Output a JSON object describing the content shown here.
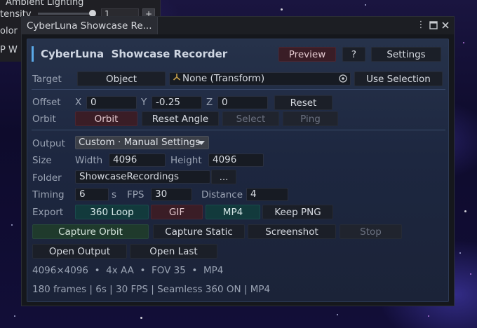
{
  "inspector": {
    "ambient_label": "Ambient Lighting",
    "intensity_label": "tensity",
    "intensity_value": "1",
    "plus_label": "+",
    "color_label": "olor",
    "p_label": "P W"
  },
  "window": {
    "tab_title": "CyberLuna Showcase Re...",
    "menu_icon": "kebab-menu-icon",
    "maximize_icon": "maximize-icon",
    "close_icon": "close-icon"
  },
  "header": {
    "title": "CyberLuna  Showcase Recorder",
    "preview": "Preview",
    "help": "?",
    "settings": "Settings"
  },
  "target": {
    "label": "Target",
    "object_button": "Object",
    "field_value": "None (Transform)",
    "use_selection": "Use Selection"
  },
  "offset": {
    "label": "Offset",
    "x_label": "X",
    "x_value": "0",
    "y_label": "Y",
    "y_value": "-0.25",
    "z_label": "Z",
    "z_value": "0",
    "reset": "Reset"
  },
  "orbit": {
    "label": "Orbit",
    "orbit_button": "Orbit",
    "reset_angle": "Reset Angle",
    "select": "Select",
    "ping": "Ping"
  },
  "output": {
    "label": "Output",
    "dropdown_value": "Custom · Manual Settings"
  },
  "size": {
    "label": "Size",
    "width_label": "Width",
    "width_value": "4096",
    "height_label": "Height",
    "height_value": "4096"
  },
  "folder": {
    "label": "Folder",
    "value": "ShowcaseRecordings",
    "browse": "..."
  },
  "timing": {
    "label": "Timing",
    "seconds_value": "6",
    "seconds_unit": "s",
    "fps_label": "FPS",
    "fps_value": "30",
    "distance_label": "Distance",
    "distance_value": "4"
  },
  "export": {
    "label": "Export",
    "loop": "360 Loop",
    "gif": "GIF",
    "mp4": "MP4",
    "keep_png": "Keep PNG"
  },
  "actions": {
    "capture_orbit": "Capture Orbit",
    "capture_static": "Capture Static",
    "screenshot": "Screenshot",
    "stop": "Stop",
    "open_output": "Open Output",
    "open_last": "Open Last"
  },
  "info": {
    "line1": "4096×4096  •  4x AA  •  FOV 35  •  MP4",
    "line2": "180 frames | 6s | 30 FPS | Seamless 360 ON | MP4"
  },
  "colors": {
    "accent": "#5aa9e8",
    "orbit_active": "#3a1d26",
    "export_active": "#123a3c",
    "capture": "#1f3a2c"
  }
}
